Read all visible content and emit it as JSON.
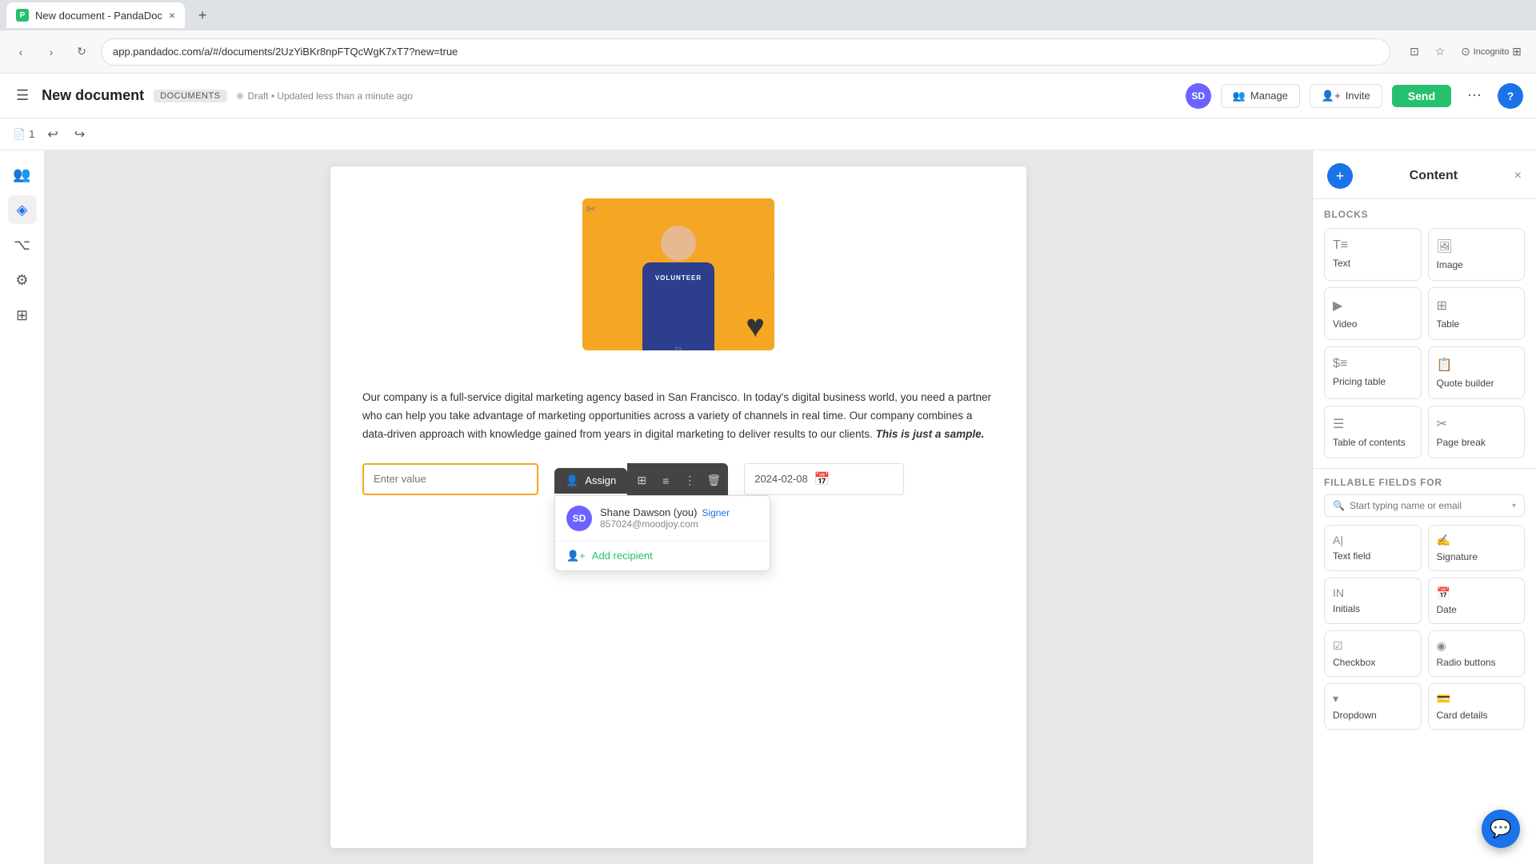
{
  "browser": {
    "tab_title": "New document - PandaDoc",
    "tab_close": "×",
    "tab_new": "+",
    "address": "app.pandadoc.com/a/#/documents/2UzYiBKr8npFTQcWgK7xT7?new=true",
    "nav_back": "‹",
    "nav_forward": "›",
    "nav_refresh": "↻",
    "incognito_label": "Incognito"
  },
  "header": {
    "hamburger": "☰",
    "doc_title": "New document",
    "doc_badge": "DOCUMENTS",
    "status_text": "Draft • Updated less than a minute ago",
    "avatar_initials": "SD",
    "manage_label": "Manage",
    "invite_label": "Invite",
    "send_label": "Send",
    "more_icon": "⋯",
    "help_label": "?"
  },
  "toolbar": {
    "page_icon": "📄",
    "page_num": "1",
    "undo_icon": "↩",
    "redo_icon": "↪"
  },
  "sidebar_left": {
    "icons": [
      {
        "name": "people-icon",
        "symbol": "👥"
      },
      {
        "name": "shapes-icon",
        "symbol": "◈"
      },
      {
        "name": "code-icon",
        "symbol": "⌥"
      },
      {
        "name": "integrations-icon",
        "symbol": "⚏"
      },
      {
        "name": "grid-icon",
        "symbol": "⊞"
      }
    ]
  },
  "document": {
    "body_text": "Our company is a full-service digital marketing agency based in San Francisco. In today's digital business world, you need a partner who can help you take advantage of marketing opportunities across a variety of channels in real time. Our company combines a data-driven approach with knowledge gained from years in digital marketing to deliver results to our clients.",
    "body_text_em": "This is just a sample.",
    "input_placeholder": "Enter value",
    "date_value": "2024-02-08",
    "add_icon": "+"
  },
  "assign_menu": {
    "assign_label": "Assign",
    "icon1": "⊞",
    "icon2": "≡",
    "icon3": "⋮",
    "trash_icon": "🗑",
    "recipient_avatar": "SD",
    "recipient_name": "Shane Dawson (you)",
    "recipient_role": "Signer",
    "recipient_email": "857024@moodjoy.com",
    "add_recipient_label": "Add recipient"
  },
  "right_panel": {
    "title": "Content",
    "close_icon": "×",
    "add_icon": "+",
    "blocks_label": "BLOCKS",
    "blocks": [
      {
        "id": "text",
        "label": "Text",
        "icon": "T"
      },
      {
        "id": "image",
        "label": "Image",
        "icon": "🖼"
      },
      {
        "id": "video",
        "label": "Video",
        "icon": "▶"
      },
      {
        "id": "table",
        "label": "Table",
        "icon": "⊞"
      },
      {
        "id": "pricing-table",
        "label": "Pricing table",
        "icon": "$"
      },
      {
        "id": "quote-builder",
        "label": "Quote builder",
        "icon": "📋"
      },
      {
        "id": "table-of-contents",
        "label": "Table of contents",
        "icon": "≡"
      },
      {
        "id": "page-break",
        "label": "Page break",
        "icon": "✂"
      }
    ],
    "fillable_label": "FILLABLE FIELDS FOR",
    "fillable_search_placeholder": "Start typing name or email",
    "fillable_items": [
      {
        "id": "text-field",
        "label": "Text field",
        "icon": "A|"
      },
      {
        "id": "signature",
        "label": "Signature",
        "icon": "✍"
      },
      {
        "id": "initials",
        "label": "Initials",
        "icon": "IN"
      },
      {
        "id": "date",
        "label": "Date",
        "icon": "📅"
      },
      {
        "id": "checkbox",
        "label": "Checkbox",
        "icon": "☑"
      },
      {
        "id": "radio-buttons",
        "label": "Radio buttons",
        "icon": "◉"
      },
      {
        "id": "dropdown",
        "label": "Dropdown",
        "icon": "▾"
      },
      {
        "id": "card-details",
        "label": "Card details",
        "icon": "💳"
      }
    ]
  }
}
